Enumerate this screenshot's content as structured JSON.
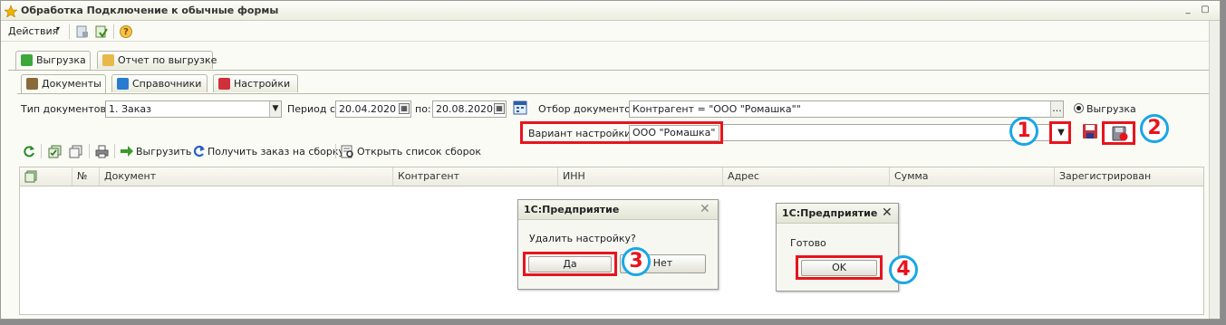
{
  "window": {
    "title": "Обработка  Подключение к обычные формы",
    "min_btn": "_",
    "restore_btn": "▢"
  },
  "menu": {
    "actions": "Действия",
    "help_glyph": "?"
  },
  "main_tabs": [
    {
      "label": "Выгрузка"
    },
    {
      "label": "Отчет по выгрузке"
    }
  ],
  "sub_tabs": [
    {
      "label": "Документы"
    },
    {
      "label": "Справочники"
    },
    {
      "label": "Настройки"
    }
  ],
  "filters": {
    "doc_type_label": "Тип документов:",
    "doc_type_value": "1. Заказ",
    "period_from_label": "Период с:",
    "period_from": "20.04.2020",
    "period_to_label": "по:",
    "period_to": "20.08.2020",
    "doc_filter_label": "Отбор документов:",
    "doc_filter_value": "Контрагент = \"ООО \"Ромашка\"\"",
    "ellipsis": "...",
    "radio_label": "Выгрузка",
    "variant_label": "Вариант настройки:",
    "variant_value": "ООО \"Ромашка\""
  },
  "toolbar": {
    "unload": "Выгрузить",
    "get_order": "Получить заказ на сборку",
    "open_list": "Открыть список сборок"
  },
  "table": {
    "columns": [
      "№",
      "Документ",
      "Контрагент",
      "ИНН",
      "Адрес",
      "Сумма",
      "Зарегистрирован"
    ]
  },
  "dialog_delete": {
    "title": "1С:Предприятие",
    "message": "Удалить настройку?",
    "yes": "Да",
    "no": "Нет"
  },
  "dialog_done": {
    "title": "1С:Предприятие",
    "message": "Готово",
    "ok": "OK"
  },
  "annotations": [
    "1",
    "2",
    "3",
    "4"
  ],
  "colors": {
    "annotation_red": "#e8141c",
    "annotation_blue": "#19a7e6"
  }
}
